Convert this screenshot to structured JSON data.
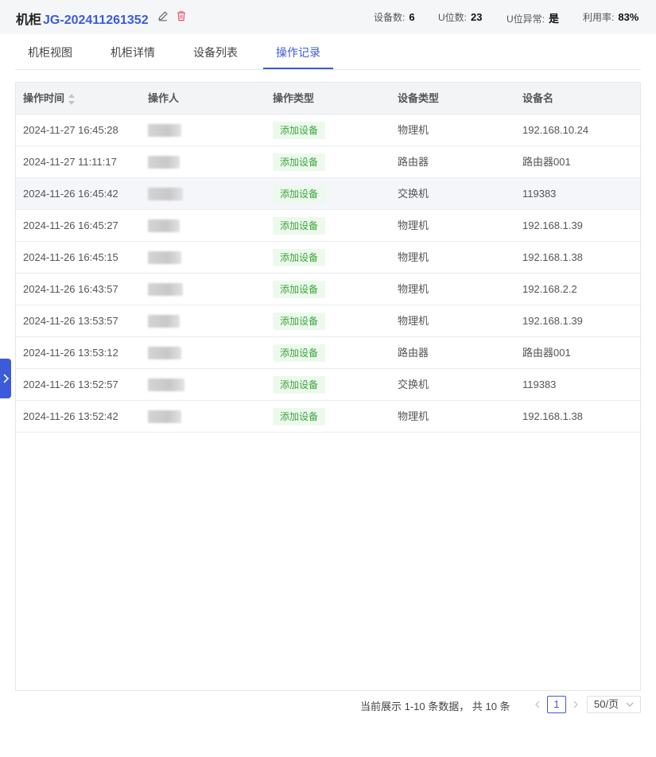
{
  "header": {
    "title_prefix": "机柜",
    "cabinet_code": "JG-202411261352",
    "stats": [
      {
        "label": "设备数:",
        "value": "6"
      },
      {
        "label": "U位数:",
        "value": "23"
      },
      {
        "label": "U位异常:",
        "value": "是"
      },
      {
        "label": "利用率:",
        "value": "83%"
      }
    ]
  },
  "tabs": [
    {
      "label": "机柜视图",
      "active": false
    },
    {
      "label": "机柜详情",
      "active": false
    },
    {
      "label": "设备列表",
      "active": false
    },
    {
      "label": "操作记录",
      "active": true
    }
  ],
  "table": {
    "columns": [
      "操作时间",
      "操作人",
      "操作类型",
      "设备类型",
      "设备名"
    ],
    "rows": [
      {
        "time": "2024-11-27 16:45:28",
        "operator": "",
        "op_type": "添加设备",
        "device_type": "物理机",
        "device_name": "192.168.10.24"
      },
      {
        "time": "2024-11-27 11:11:17",
        "operator": "",
        "op_type": "添加设备",
        "device_type": "路由器",
        "device_name": "路由器001"
      },
      {
        "time": "2024-11-26 16:45:42",
        "operator": "",
        "op_type": "添加设备",
        "device_type": "交换机",
        "device_name": "119383"
      },
      {
        "time": "2024-11-26 16:45:27",
        "operator": "",
        "op_type": "添加设备",
        "device_type": "物理机",
        "device_name": "192.168.1.39"
      },
      {
        "time": "2024-11-26 16:45:15",
        "operator": "",
        "op_type": "添加设备",
        "device_type": "物理机",
        "device_name": "192.168.1.38"
      },
      {
        "time": "2024-11-26 16:43:57",
        "operator": "",
        "op_type": "添加设备",
        "device_type": "物理机",
        "device_name": "192.168.2.2"
      },
      {
        "time": "2024-11-26 13:53:57",
        "operator": "",
        "op_type": "添加设备",
        "device_type": "物理机",
        "device_name": "192.168.1.39"
      },
      {
        "time": "2024-11-26 13:53:12",
        "operator": "",
        "op_type": "添加设备",
        "device_type": "路由器",
        "device_name": "路由器001"
      },
      {
        "time": "2024-11-26 13:52:57",
        "operator": "",
        "op_type": "添加设备",
        "device_type": "交换机",
        "device_name": "119383"
      },
      {
        "time": "2024-11-26 13:52:42",
        "operator": "",
        "op_type": "添加设备",
        "device_type": "物理机",
        "device_name": "192.168.1.38"
      }
    ]
  },
  "pagination": {
    "summary": "当前展示 1-10 条数据， 共 10 条",
    "current_page": "1",
    "page_size": "50/页"
  },
  "colors": {
    "accent": "#3b5bdb",
    "tag_text": "#3aa63a",
    "tag_bg": "#edf9ed",
    "delete_icon": "#f0506e"
  },
  "icons": [
    "edit-icon",
    "delete-icon",
    "sort-icon",
    "chevron-right-icon",
    "chevron-left-icon",
    "chevron-down-icon"
  ]
}
